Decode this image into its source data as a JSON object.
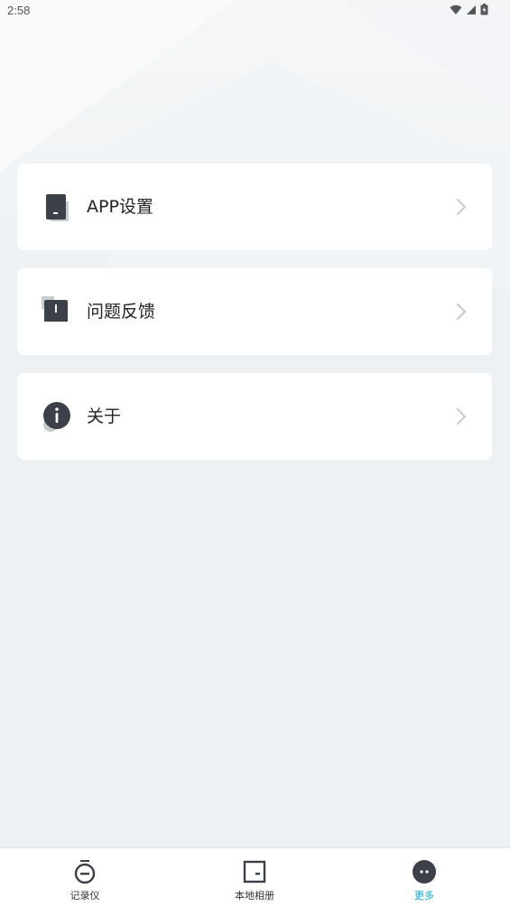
{
  "status_bar": {
    "time": "2:58",
    "icons": [
      "wifi-icon",
      "cell-signal-icon",
      "battery-icon"
    ]
  },
  "menu": {
    "items": [
      {
        "label": "APP设置",
        "icon": "phone-settings-icon"
      },
      {
        "label": "问题反馈",
        "icon": "feedback-icon"
      },
      {
        "label": "关于",
        "icon": "info-icon"
      }
    ]
  },
  "tab_bar": {
    "tabs": [
      {
        "label": "记录仪",
        "icon": "recorder-icon",
        "active": false
      },
      {
        "label": "本地相册",
        "icon": "album-icon",
        "active": false
      },
      {
        "label": "更多",
        "icon": "more-icon",
        "active": true
      }
    ],
    "active_color": "#16a8c8"
  },
  "colors": {
    "background": "#edf1f4",
    "card": "#ffffff",
    "icon_dark": "#3b4049"
  }
}
